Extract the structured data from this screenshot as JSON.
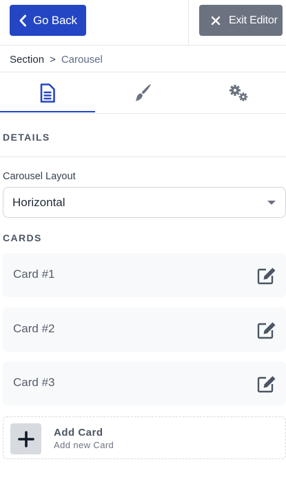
{
  "header": {
    "back_label": "Go Back",
    "exit_label": "Exit Editor"
  },
  "breadcrumb": {
    "parent": "Section",
    "separator": ">",
    "current": "Carousel"
  },
  "tabs": [
    {
      "name": "content",
      "icon": "document-icon",
      "active": true
    },
    {
      "name": "style",
      "icon": "paintbrush-icon",
      "active": false
    },
    {
      "name": "settings",
      "icon": "gears-icon",
      "active": false
    }
  ],
  "details": {
    "heading": "DETAILS",
    "layout_label": "Carousel Layout",
    "layout_value": "Horizontal"
  },
  "cards": {
    "heading": "CARDS",
    "items": [
      {
        "label": "Card #1"
      },
      {
        "label": "Card #2"
      },
      {
        "label": "Card #3"
      }
    ],
    "add": {
      "title": "Add Card",
      "subtitle": "Add new Card"
    }
  },
  "colors": {
    "primary": "#2446c4",
    "secondary": "#6b7280",
    "card_bg": "#f8f9fb"
  }
}
